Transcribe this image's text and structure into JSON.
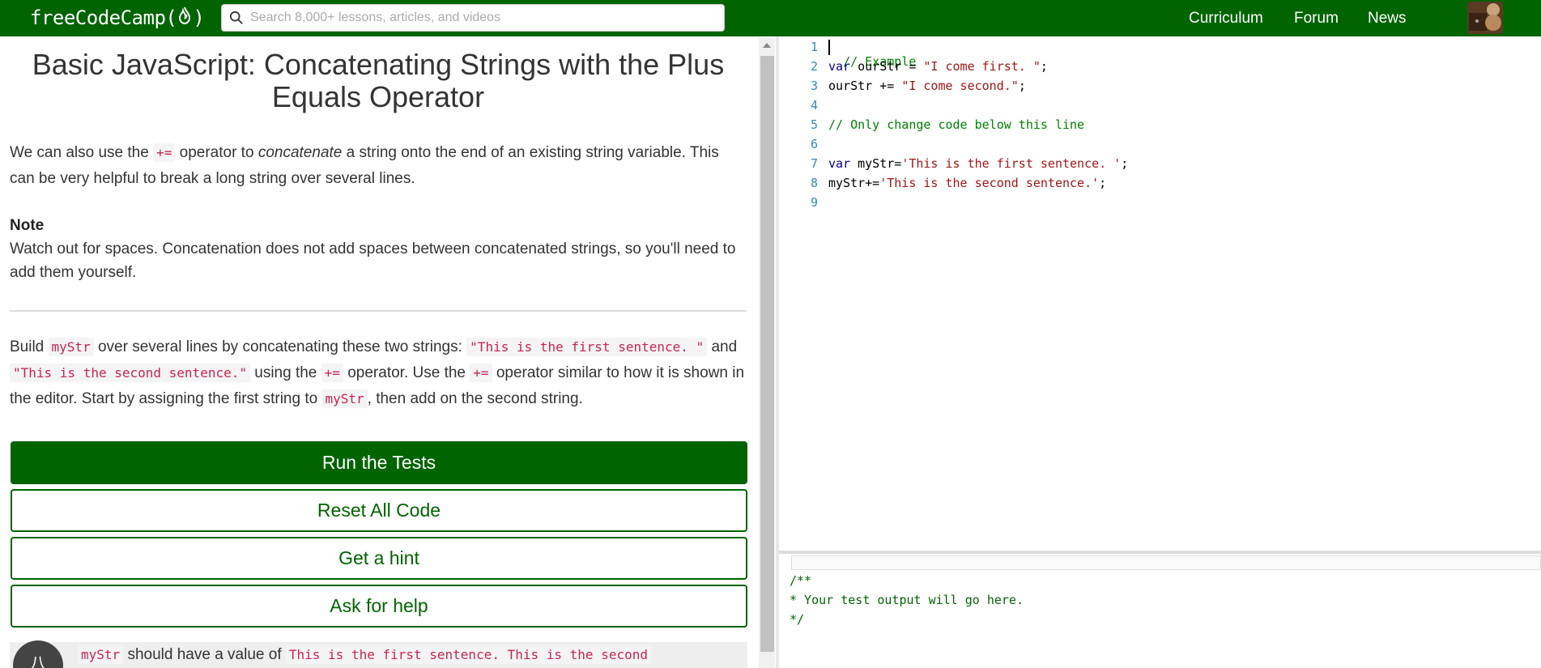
{
  "nav": {
    "logo_text_left": "freeCodeCamp(",
    "logo_text_right": ")",
    "search_placeholder": "Search 8,000+ lessons, articles, and videos",
    "links": [
      "Curriculum",
      "Forum",
      "News"
    ],
    "brand_color": "#006400"
  },
  "lesson": {
    "title": "Basic JavaScript: Concatenating Strings with the Plus Equals Operator",
    "intro_p1": "We can also use the",
    "intro_code": "+=",
    "intro_p2": "operator to",
    "intro_em": "concatenate",
    "intro_p3": "a string onto the end of an existing string variable. This can be very helpful to break a long string over several lines.",
    "note_heading": "Note",
    "note_text": "Watch out for spaces. Concatenation does not add spaces between concatenated strings, so you'll need to add them yourself.",
    "task": {
      "t1": "Build",
      "c1": "myStr",
      "t2": "over several lines by concatenating these two strings:",
      "c2": "\"This is the first sentence. \"",
      "t3": "and",
      "c3": "\"This is the second sentence.\"",
      "t4": "using the",
      "c4": "+=",
      "t5": "operator. Use the",
      "c5": "+=",
      "t6": "operator similar to how it is shown in the editor. Start by assigning the first string to",
      "c6": "myStr",
      "t7": ", then add on the second string."
    }
  },
  "buttons": {
    "run": "Run the Tests",
    "reset": "Reset All Code",
    "hint": "Get a hint",
    "help": "Ask for help"
  },
  "test": {
    "icon": "八",
    "code1": "myStr",
    "text1": "should have a value of",
    "code2": "This is the first sentence. This is the second"
  },
  "editor": {
    "line_numbers": [
      "1",
      "2",
      "3",
      "4",
      "5",
      "6",
      "7",
      "8",
      "9"
    ],
    "lines": {
      "l1": "// Example",
      "l2_kw": "var",
      "l2_mid": " ourStr = ",
      "l2_str": "\"I come first. \"",
      "l2_end": ";",
      "l3_a": "ourStr += ",
      "l3_str": "\"I come second.\"",
      "l3_end": ";",
      "l5": "// Only change code below this line",
      "l7_kw": "var",
      "l7_mid": " myStr=",
      "l7_str": "'This is the first sentence. '",
      "l7_end": ";",
      "l8_a": "myStr+=",
      "l8_str": "'This is the second sentence.'",
      "l8_end": ";"
    }
  },
  "output": {
    "lines": [
      "/**",
      "* Your test output will go here.",
      "*/"
    ]
  }
}
